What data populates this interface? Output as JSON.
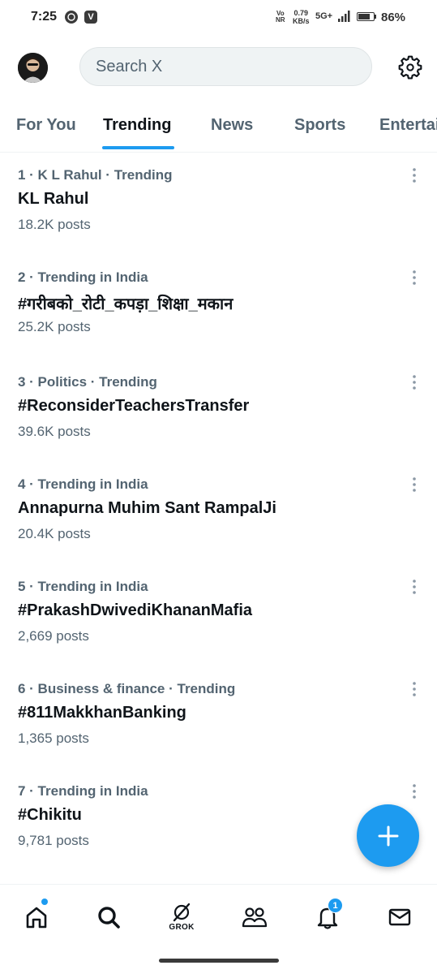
{
  "status_bar": {
    "time": "7:25",
    "app_icon_1": "whatsapp-icon",
    "app_icon_2": "V",
    "network_type_top": "Vo",
    "network_type_bottom": "NR",
    "speed_value": "0.79",
    "speed_unit": "KB/s",
    "network": "5G+",
    "battery_percent_value": 86,
    "battery_label": "86%"
  },
  "header": {
    "avatar_icon": "profile-avatar",
    "search_placeholder": "Search X",
    "settings_icon": "gear-icon"
  },
  "tabs": [
    {
      "label": "For You",
      "active": false
    },
    {
      "label": "Trending",
      "active": true
    },
    {
      "label": "News",
      "active": false
    },
    {
      "label": "Sports",
      "active": false
    },
    {
      "label": "Entertainment",
      "active": false
    }
  ],
  "trends": [
    {
      "meta": "1 · K L Rahul · Trending",
      "name": "KL Rahul",
      "count": "18.2K posts"
    },
    {
      "meta": "2 · Trending in India",
      "name": "#गरीबको_रोटी_कपड़ा_शिक्षा_मकान",
      "count": "25.2K posts"
    },
    {
      "meta": "3 · Politics · Trending",
      "name": "#ReconsiderTeachersTransfer",
      "count": "39.6K posts"
    },
    {
      "meta": "4 · Trending in India",
      "name": "Annapurna Muhim Sant RampalJi",
      "count": "20.4K posts"
    },
    {
      "meta": "5 · Trending in India",
      "name": "#PrakashDwivediKhananMafia",
      "count": "2,669 posts"
    },
    {
      "meta": "6 · Business & finance · Trending",
      "name": "#811MakkhanBanking",
      "count": "1,365 posts"
    },
    {
      "meta": "7 · Trending in India",
      "name": "#Chikitu",
      "count": "9,781 posts"
    }
  ],
  "fab": {
    "icon": "plus-icon"
  },
  "bottom_nav": {
    "home_icon": "home-icon",
    "search_icon": "search-icon",
    "grok_label": "GROK",
    "communities_icon": "people-icon",
    "notifications_icon": "bell-icon",
    "notification_count": "1",
    "messages_icon": "mail-icon"
  },
  "colors": {
    "accent": "#1d9bf0",
    "text_primary": "#0f1419",
    "text_secondary": "#536471",
    "search_bg": "#eff3f4"
  }
}
